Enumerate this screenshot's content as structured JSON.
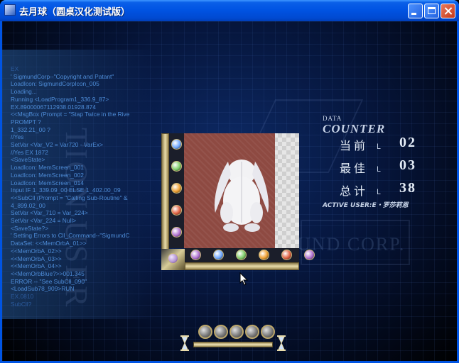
{
  "window": {
    "title": "去月球（圆桌汉化测试版）",
    "controls": [
      "minimize",
      "maximize",
      "close"
    ]
  },
  "background": {
    "watermark_vertical": "TION USER",
    "watermark_corp": "UND CORP.",
    "code_lines": [
      "EX",
      "' SigmundCorp--\"Copyright and Patant\"",
      "LoadIcon: SigmundCorpIcon_005",
      "Loading...",
      "Running <LoadProgram1_336.9_87>",
      "EX.89000067112938.01928.874",
      "<<MsgBox (Prompt = \"Stap Twice in the Rive",
      "PROMPT ?",
      "  1_332.21_00 ?",
      " //Yes",
      "SetVar <Var_V2 = Var720 - VarEx>",
      "  //Yes    EX  1872",
      "<SaveState>",
      "LoadIcon: MemScreen_001",
      "LoadIcon: MemScreen_002",
      "LoadIcon: MemScreen_014",
      "Input IF 1_339.09_00 ELSE 1_402.00_09",
      "<<SubCll (Prompt = \"Calling Sub-Routine\" &",
      "  4_899.02_00",
      "SetVar <Var_710 = Var_224>",
      "SetVar <Var_224 = Null>",
      "<SaveState?>",
      "' Setting Errors to Cll_Command--\"SigmundC",
      "DataSet: <<MemOrbA_01>>",
      "  <<MemOrbA_02>>",
      "  <<MemOrbA_03>>",
      "  <<MemOrbA_04>>",
      "  <<MemOrbBlue?>>001.345",
      "ERROR -- \"See SubCll_090\"",
      "<LoadSub78_909>RUN",
      "EX.0810",
      "  SubCll?"
    ]
  },
  "counter": {
    "data_label": "DATA",
    "counter_label": "COUNTER",
    "rows": [
      {
        "label": "当前",
        "value": "02"
      },
      {
        "label": "最佳",
        "value": "03"
      },
      {
        "label": "总计",
        "value": "38"
      }
    ],
    "active_user": "ACTIVE USER:E・罗莎莉恩"
  },
  "board": {
    "column_orbs": [
      "blue",
      "green",
      "orange",
      "red",
      "purple"
    ],
    "row_orbs": [
      "purple",
      "blue",
      "green",
      "orange",
      "red",
      "purple"
    ],
    "picture": "white-rabbit-on-red-tile"
  },
  "bottom": {
    "memory_orbs": 5,
    "colors": {
      "gold": "#e9dcaa",
      "text": "#4d8bd6",
      "titlebar": "#0054e3"
    }
  }
}
